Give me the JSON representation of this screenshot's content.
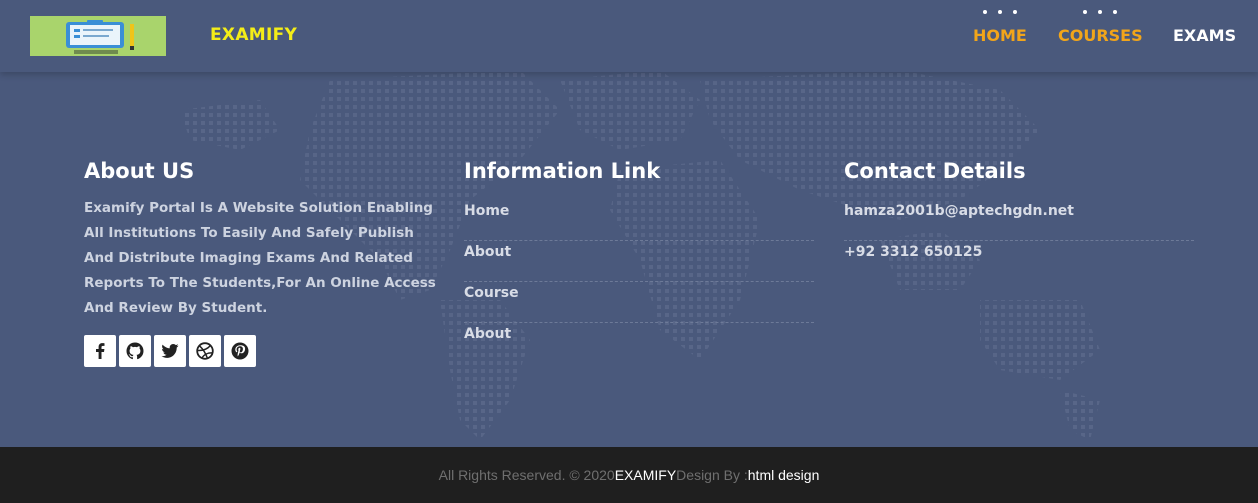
{
  "header": {
    "brand": "EXAMIFY",
    "nav": [
      {
        "label": "HOME"
      },
      {
        "label": "COURSES"
      },
      {
        "label": "EXAMS"
      }
    ]
  },
  "about": {
    "title": "About US",
    "text": "Examify Portal Is A Website Solution Enabling All Institutions To Easily And Safely Publish And Distribute Imaging Exams And Related Reports To The Students,For An Online Access And Review By Student.",
    "social_icons": [
      "facebook-icon",
      "github-icon",
      "twitter-icon",
      "dribbble-icon",
      "pinterest-icon"
    ]
  },
  "info": {
    "title": "Information Link",
    "links": [
      {
        "label": "Home"
      },
      {
        "label": "About"
      },
      {
        "label": "Course"
      },
      {
        "label": "About"
      }
    ]
  },
  "contact": {
    "title": "Contact Details",
    "email": "hamza2001b@aptechgdn.net",
    "phone": "+92 3312 650125"
  },
  "footer": {
    "prefix": "All Rights Reserved. © 2020 ",
    "brand": "EXAMIFY",
    "middle": " Design By : ",
    "designer": "html design"
  },
  "colors": {
    "background": "#4a597c",
    "brand_yellow": "#f4ed18",
    "nav_active": "#f2a51a",
    "footer_bg": "#1f1f1f"
  }
}
